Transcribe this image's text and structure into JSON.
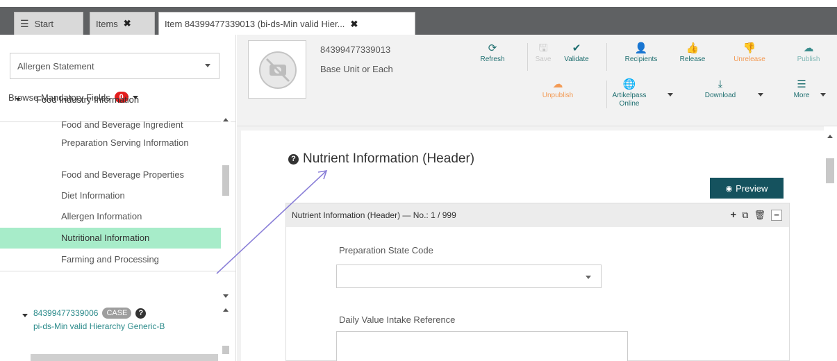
{
  "tabs": [
    {
      "label": "Start",
      "icon": "hamburger-icon"
    },
    {
      "label": "Items",
      "close": "✖"
    },
    {
      "label": "Item 84399477339013 (bi-ds-Min valid Hier...",
      "close": "✖"
    }
  ],
  "sidebar": {
    "select_value": "Allergen Statement",
    "mandatory_label": "Browse Mandatory Fields",
    "mandatory_count": "0",
    "group_label": "Food Industry Information",
    "items": [
      "Food and Beverage Ingredient",
      "Preparation Serving Information",
      "Food and Beverage Properties",
      "Diet Information",
      "Allergen Information",
      "Nutritional Information",
      "Farming and Processing"
    ],
    "selected_index": 5,
    "bundle": {
      "gtin": "84399477339006",
      "badge": "CASE",
      "name": "pi-ds-Min valid Hierarchy Generic-B"
    }
  },
  "item": {
    "gtin": "84399477339013",
    "unit": "Base Unit or Each"
  },
  "toolbar": {
    "refresh": "Refresh",
    "save": "Save",
    "validate": "Validate",
    "recipients": "Recipients",
    "release": "Release",
    "unrelease": "Unrelease",
    "publish": "Publish",
    "unpublish": "Unpublish",
    "artikelpass_line1": "Artikelpass",
    "artikelpass_line2": "Online",
    "download": "Download",
    "more": "More"
  },
  "main": {
    "section_title": "Nutrient Information (Header)",
    "preview_label": "Preview",
    "panel_title": "Nutrient Information (Header) — No.: 1 / 999",
    "fields": [
      {
        "label": "Preparation State Code",
        "value": ""
      },
      {
        "label": "Daily Value Intake Reference",
        "value": ""
      }
    ]
  },
  "colors": {
    "selected_bg": "#a7ecc9",
    "preview_bg": "#15525e",
    "badge_red": "#e31d1d",
    "link_teal": "#2a8a8a",
    "arrow": "#8a7fd8"
  }
}
